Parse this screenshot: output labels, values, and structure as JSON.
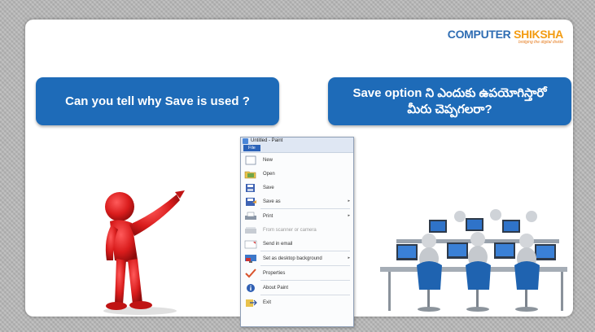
{
  "logo": {
    "brand_part1": "COMPUTER",
    "brand_part2": " SHIKSHA",
    "tagline": "bridging the digital divide"
  },
  "left_callout": {
    "text": "Can you tell why Save is used ?"
  },
  "right_callout": {
    "line1": "Save option ని ఎందుకు ఉపయోగిస్తారో",
    "line2": "మీరు చెప్పగలరా?"
  },
  "paint": {
    "title": "Untitled - Paint",
    "file_tab": "File",
    "menu": [
      {
        "label": "New",
        "icon": "new-document-icon"
      },
      {
        "label": "Open",
        "icon": "open-folder-icon"
      },
      {
        "label": "Save",
        "icon": "save-disk-icon"
      },
      {
        "label": "Save as",
        "icon": "save-as-icon",
        "submenu": true
      },
      {
        "label": "Print",
        "icon": "printer-icon",
        "submenu": true
      },
      {
        "label": "From scanner or camera",
        "icon": "scanner-icon",
        "disabled": true
      },
      {
        "label": "Send in email",
        "icon": "email-icon"
      },
      {
        "label": "Set as desktop background",
        "icon": "desktop-background-icon",
        "submenu": true
      },
      {
        "label": "Properties",
        "icon": "properties-check-icon"
      },
      {
        "label": "About Paint",
        "icon": "info-icon"
      },
      {
        "label": "Exit",
        "icon": "exit-icon"
      }
    ]
  },
  "colors": {
    "callout_blue": "#1e6bb8",
    "figure_red": "#d91c1c",
    "chair_blue": "#1f63b0"
  }
}
